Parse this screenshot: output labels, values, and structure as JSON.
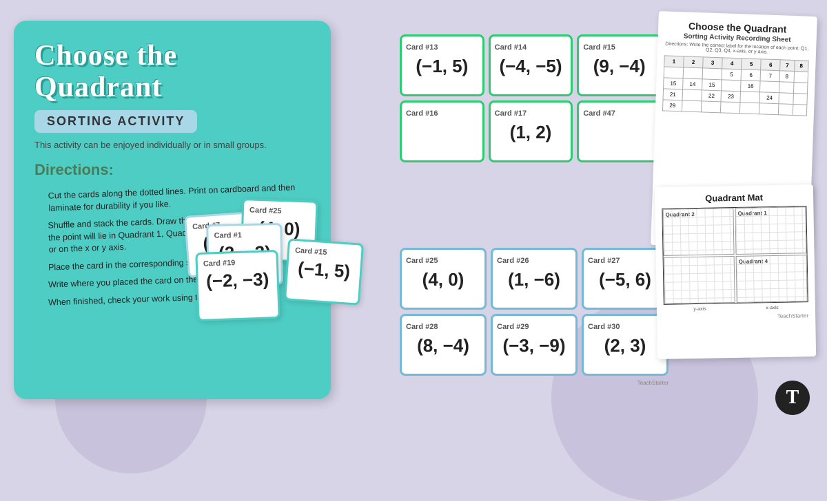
{
  "background": {
    "color": "#d8d4e8"
  },
  "instruction_card": {
    "title": "Choose the Quadrant",
    "badge": "SORTING ACTIVITY",
    "subtitle": "This activity can be enjoyed individually or in small groups.",
    "directions_title": "Directions:",
    "directions": [
      "Cut the cards along the dotted lines. Print on cardboard and then laminate for durability if you like.",
      "Shuffle and stack the cards. Draw the top card and decide whether the point will lie in Quadrant 1, Quadrant 2, Quadrant 3, Quadrant 4, or on the x or y axis.",
      "Place the card in the corresponding spot on the Quadrant Mat.",
      "Write where you placed the card on the recording sheet.",
      "When finished, check your work using the answer key."
    ]
  },
  "sorting_cards": [
    {
      "label": "Card #7",
      "value": "(4, 1)"
    },
    {
      "label": "Card #1",
      "value": "(2, −3)"
    },
    {
      "label": "Card #25",
      "value": "(4, 0)"
    },
    {
      "label": "Card #15",
      "value": "(−1, 5)"
    },
    {
      "label": "Card #19",
      "value": "(−2, −3)"
    }
  ],
  "green_cards": {
    "row1": [
      {
        "label": "Card #13",
        "value": "(−1, 5)"
      },
      {
        "label": "Card #14",
        "value": "(−4, −5)"
      },
      {
        "label": "Card #15",
        "value": "(9, −4)"
      }
    ],
    "row2": [
      {
        "label": "Card #16",
        "value": ""
      },
      {
        "label": "Card #17",
        "value": "(1, 2)"
      },
      {
        "label": "Card #47",
        "value": ""
      }
    ]
  },
  "blue_cards": {
    "row1": [
      {
        "label": "Card #25",
        "value": "(4, 0)"
      },
      {
        "label": "Card #26",
        "value": "(1, −6)"
      },
      {
        "label": "Card #27",
        "value": "(−5, 6)"
      }
    ],
    "row2": [
      {
        "label": "Card #28",
        "value": "(8, −4)"
      },
      {
        "label": "Card #29",
        "value": "(−3, −9)"
      },
      {
        "label": "Card #30",
        "value": "(2, 3)"
      }
    ]
  },
  "recording_sheet": {
    "title": "Choose the Quadrant",
    "subtitle": "Sorting Activity Recording Sheet",
    "directions": "Directions: Write the correct label for the location of each point: Q1, Q2, Q3, Q4, x-axis, or y-axis.",
    "columns": [
      "1",
      "2",
      "3",
      "4",
      "5",
      "6",
      "7",
      "8"
    ],
    "rows": [
      [
        "5",
        "6",
        "7",
        "8",
        ""
      ],
      [
        "",
        "13",
        "14",
        "15",
        "16"
      ],
      [
        "21",
        "22",
        "23",
        "24"
      ],
      [
        "29",
        ""
      ]
    ]
  },
  "quadrant_mat": {
    "title": "Quadrant Mat",
    "quadrants": [
      {
        "label": "Quadrant 2"
      },
      {
        "label": "Quadrant 1"
      },
      {
        "label": ""
      },
      {
        "label": "Quadrant 4"
      }
    ],
    "axes": [
      "y-axis",
      "x-axis"
    ]
  },
  "logo": {
    "symbol": "T"
  },
  "brand": "TeachStarter"
}
